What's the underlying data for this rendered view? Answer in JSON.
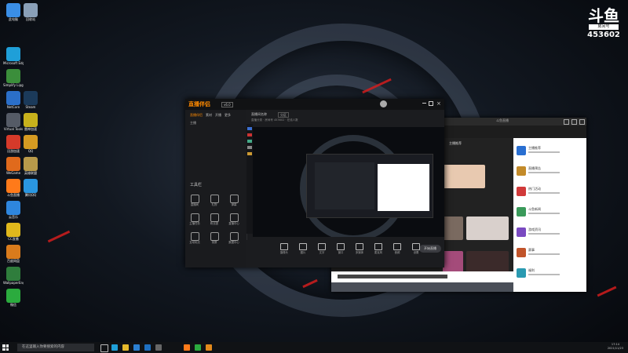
{
  "colors": {
    "accent": "#ff8a00",
    "wallpaper_red": "#d21d1d"
  },
  "desktop": {
    "icons": [
      {
        "label": "此电脑",
        "icon": "computer-icon",
        "color": "#3a8ee6"
      },
      {
        "label": "回收站",
        "icon": "recycle-bin-icon",
        "color": "#8aa0b8"
      },
      {
        "label": "Microsoft Edge",
        "icon": "edge-icon",
        "color": "#1f9fd8"
      },
      {
        "label": "Simplify Lipgloss",
        "icon": "app-icon",
        "color": "#3b8e3b"
      },
      {
        "label": "NetCore",
        "icon": "app-icon",
        "color": "#2b6fc9"
      },
      {
        "label": "Steam",
        "icon": "steam-icon",
        "color": "#1b3a5a"
      },
      {
        "label": "Virtual Tools",
        "icon": "app-icon",
        "color": "#555b66"
      },
      {
        "label": "雷神加速",
        "icon": "app-icon",
        "color": "#c8b21c"
      },
      {
        "label": "迅游加速",
        "icon": "app-icon",
        "color": "#d63a2a"
      },
      {
        "label": "QQ",
        "icon": "qq-icon",
        "color": "#d69b22"
      },
      {
        "label": "WeGame",
        "icon": "wegame-icon",
        "color": "#e06a1c"
      },
      {
        "label": "英雄联盟",
        "icon": "league-icon",
        "color": "#b89a4a"
      },
      {
        "label": "斗鱼直播",
        "icon": "douyu-icon",
        "color": "#ff7a1a"
      },
      {
        "label": "腾讯QQ",
        "icon": "qq-icon",
        "color": "#2a96e0"
      },
      {
        "label": "云音乐",
        "icon": "music-icon",
        "color": "#2e86de"
      },
      {
        "label": "CC直播",
        "icon": "app-icon",
        "color": "#e0b81c"
      },
      {
        "label": "百度网盘",
        "icon": "app-icon",
        "color": "#d97b1c"
      },
      {
        "label": "WallpaperEngine",
        "icon": "app-icon",
        "color": "#2f7d3c"
      },
      {
        "label": "微信",
        "icon": "wechat-icon",
        "color": "#2bab3e"
      }
    ]
  },
  "watermark": {
    "logo": "斗鱼",
    "room_label": "房间号",
    "room_number": "453602"
  },
  "app": {
    "title": "直播伴侣",
    "version_badge": "v6.0",
    "side_tabs": [
      "直播伴侣",
      "素材",
      "开播",
      "更多"
    ],
    "user_label": "主播",
    "tools_header": "工具栏",
    "tools": [
      "直播间",
      "礼物",
      "弹幕",
      "主播任务",
      "粉丝团",
      "直播中心",
      "互动玩法",
      "录屏",
      "数据中心"
    ],
    "room_title": "直播间名称",
    "room_tag": "分区",
    "room_subtitle": "直播分类 · 房间号 453602 · 在线人数",
    "controls": [
      "摄像头",
      "图片",
      "文字",
      "窗口",
      "多媒体",
      "麦克风",
      "音频",
      "设置"
    ],
    "start_label": "开始直播"
  },
  "browser": {
    "tab_label": "斗鱼直播",
    "sidebar_title": "主播推荐",
    "sidebar_items": [
      "主播推荐",
      "直播预告",
      "热门活动",
      "斗鱼新闻",
      "游戏资讯",
      "赛事",
      "福利"
    ]
  },
  "taskbar": {
    "search_placeholder": "在这里输入你要搜索的内容",
    "time": "17:14",
    "date": "2021/11/23"
  }
}
